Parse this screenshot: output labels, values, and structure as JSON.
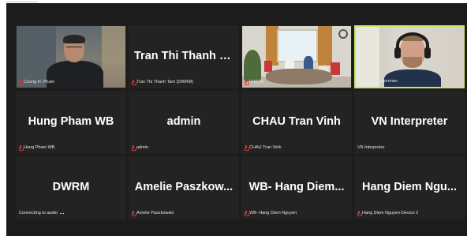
{
  "participants": [
    {
      "display_name": "",
      "label": "Cuong H. Pham",
      "has_video": true,
      "active_speaker": false
    },
    {
      "display_name": "Tran Thi Thanh T...",
      "label": "Tran Thi Thanh Tam (DWRM)",
      "has_video": false,
      "active_speaker": false
    },
    {
      "display_name": "",
      "label": "DWRM",
      "has_video": true,
      "active_speaker": false
    },
    {
      "display_name": "",
      "label": "Jonathan Gaborman",
      "has_video": true,
      "active_speaker": true
    },
    {
      "display_name": "Hung Pham WB",
      "label": "Hung Pham WB",
      "has_video": false,
      "active_speaker": false
    },
    {
      "display_name": "admin",
      "label": "admin",
      "has_video": false,
      "active_speaker": false
    },
    {
      "display_name": "CHAU Tran Vinh",
      "label": "CHAU Tran Vinh",
      "has_video": false,
      "active_speaker": false
    },
    {
      "display_name": "VN Interpreter",
      "label": "VN Interpreter",
      "has_video": false,
      "active_speaker": false,
      "muted_icon": false
    },
    {
      "display_name": "DWRM",
      "label": "Connecting to audio",
      "has_video": false,
      "active_speaker": false,
      "muted_icon": false,
      "connecting": true
    },
    {
      "display_name": "Amelie Paszkow...",
      "label": "Amelie Paszkowski",
      "has_video": false,
      "active_speaker": false
    },
    {
      "display_name": "WB- Hang Diem...",
      "label": "WB- Hang Diem Nguyen",
      "has_video": false,
      "active_speaker": false
    },
    {
      "display_name": "Hang Diem Ngu...",
      "label": "Hang Diem Nguyen-Device 2",
      "has_video": false,
      "active_speaker": false
    }
  ],
  "colors": {
    "background": "#1c1c1c",
    "tile": "#232323",
    "active_speaker_border": "#c6e66a",
    "muted_mic": "#e0373a",
    "text": "#ffffff"
  },
  "icons": {
    "muted": "mic-muted-icon",
    "connecting": "connecting-dots-icon"
  }
}
